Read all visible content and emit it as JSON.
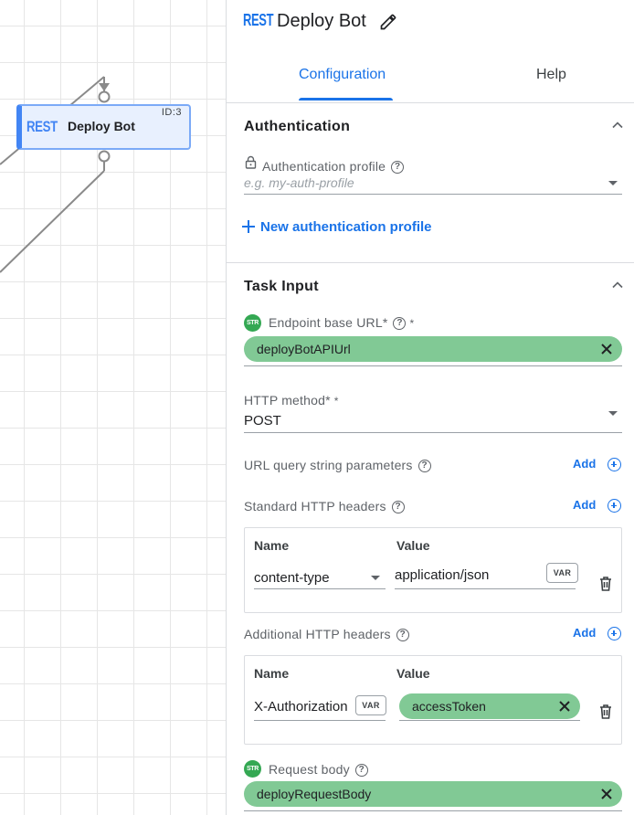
{
  "canvas": {
    "node": {
      "logo": "REST",
      "title": "Deploy Bot",
      "id_label": "ID:3"
    }
  },
  "panel": {
    "header": {
      "logo": "REST",
      "title": "Deploy Bot"
    },
    "tabs": [
      {
        "label": "Configuration",
        "active": true
      },
      {
        "label": "Help",
        "active": false
      }
    ],
    "authentication": {
      "title": "Authentication",
      "profile_label": "Authentication profile",
      "profile_placeholder": "e.g. my-auth-profile",
      "new_profile_label": "New authentication profile"
    },
    "task_input": {
      "title": "Task Input",
      "endpoint": {
        "type_badge": "STR",
        "label": "Endpoint base URL*",
        "required": "*",
        "value": "deployBotAPIUrl"
      },
      "http_method": {
        "label": "HTTP method*",
        "required": "*",
        "value": "POST"
      },
      "query_params": {
        "label": "URL query string parameters",
        "add_label": "Add"
      },
      "standard_headers": {
        "label": "Standard HTTP headers",
        "add_label": "Add",
        "columns": [
          "Name",
          "Value"
        ],
        "rows": [
          {
            "name": "content-type",
            "value": "application/json",
            "value_badge": "VAR"
          }
        ]
      },
      "additional_headers": {
        "label": "Additional HTTP headers",
        "add_label": "Add",
        "columns": [
          "Name",
          "Value"
        ],
        "rows": [
          {
            "name": "X-Authorization",
            "name_badge": "VAR",
            "value": "accessToken"
          }
        ]
      },
      "request_body": {
        "type_badge": "STR",
        "label": "Request body",
        "value": "deployRequestBody"
      }
    }
  },
  "colors": {
    "accent": "#1a73e8",
    "chip_green": "#81c995",
    "str_badge": "#34a853",
    "node_blue": "#4285f4"
  }
}
